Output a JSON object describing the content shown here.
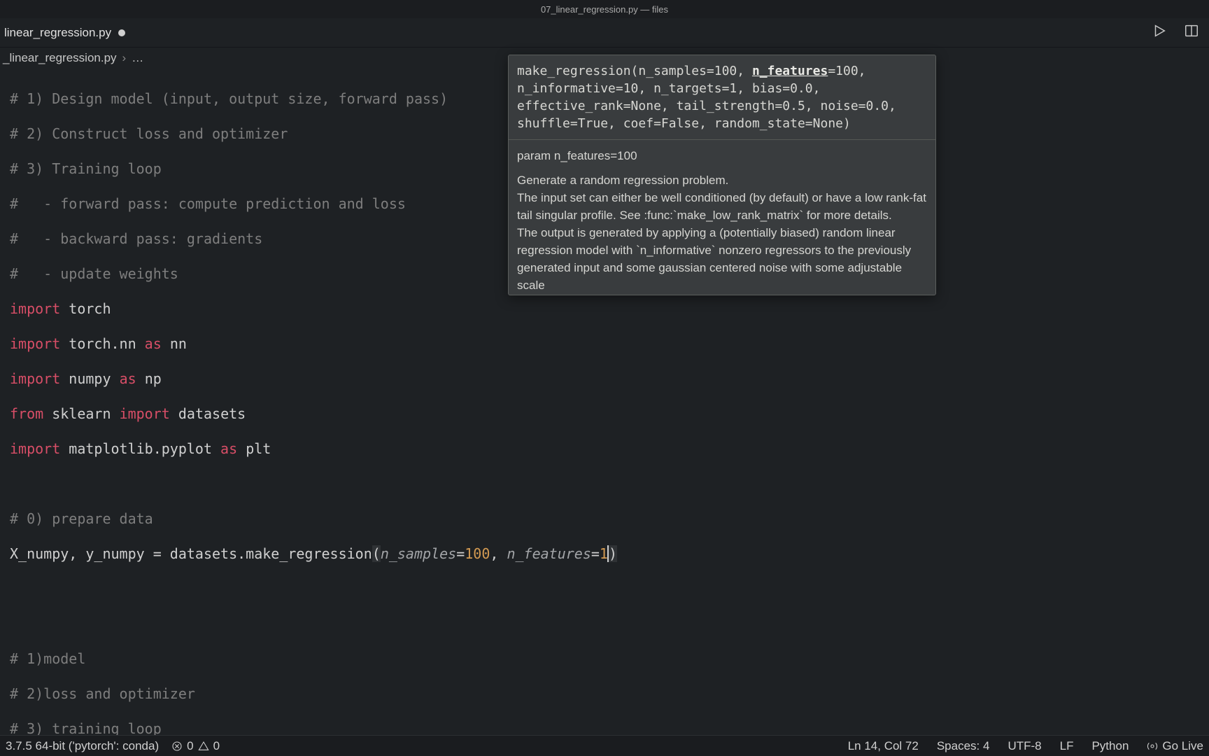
{
  "titlebar": "07_linear_regression.py — files",
  "tab": {
    "label": "linear_regression.py",
    "dirty": true
  },
  "breadcrumb": {
    "file": "_linear_regression.py",
    "symbol": "…"
  },
  "code": {
    "c1": "# 1) Design model (input, output size, forward pass)",
    "c2": "# 2) Construct loss and optimizer",
    "c3": "# 3) Training loop",
    "c4": "#   - forward pass: compute prediction and loss",
    "c5": "#   - backward pass: gradients",
    "c6": "#   - update weights",
    "imp": "import",
    "frm": "from",
    "as": "as",
    "torch": "torch",
    "torchnn": "torch.nn",
    "nn": "nn",
    "numpy": "numpy",
    "np": "np",
    "sklearn": "sklearn",
    "datasets": "datasets",
    "mpl": "matplotlib.pyplot",
    "plt": "plt",
    "c0": "# 0) prepare data",
    "assign": "X_numpy, y_numpy = datasets.make_regression",
    "lparen": "(",
    "p1": "n_samples",
    "eq": "=",
    "v1": "100",
    "comma": ", ",
    "p2": "n_features",
    "v2": "1",
    "rparen": ")",
    "c7": "# 1)model",
    "c8": "# 2)loss and optimizer",
    "c9": "# 3) training loop"
  },
  "sighelp": {
    "sig_before": "make_regression(n_samples=100, ",
    "active_param": "n_features",
    "sig_after": "=100, n_informative=10, n_targets=1, bias=0.0, effective_rank=None, tail_strength=0.5, noise=0.0, shuffle=True, coef=False, random_state=None)",
    "param_label": "param n_features=100",
    "doc_l1": "Generate a random regression problem.",
    "doc_l2": "The input set can either be well conditioned (by default) or have a low rank-fat tail singular profile. See :func:`make_low_rank_matrix` for more details.",
    "doc_l3": "The output is generated by applying a (potentially biased) random linear regression model with `n_informative` nonzero regressors to the previously generated input and some gaussian centered noise with some adjustable scale"
  },
  "status": {
    "interpreter": "3.7.5 64-bit ('pytorch': conda)",
    "errors": "0",
    "warnings": "0",
    "position": "Ln 14, Col 72",
    "spaces": "Spaces: 4",
    "encoding": "UTF-8",
    "eol": "LF",
    "lang": "Python",
    "golive": "Go Live"
  }
}
